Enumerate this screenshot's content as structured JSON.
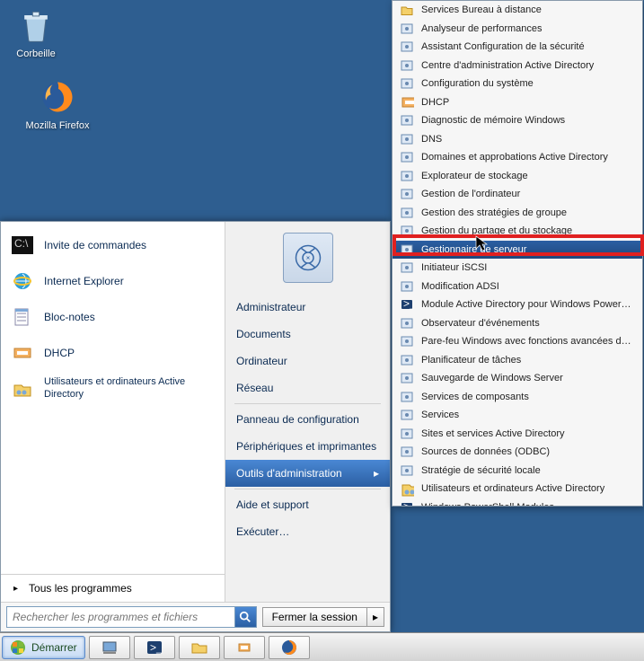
{
  "desktop": {
    "icons": [
      {
        "name": "Corbeille"
      },
      {
        "name": "Mozilla Firefox"
      }
    ]
  },
  "startmenu": {
    "pinned": [
      {
        "label": "Invite de commandes",
        "icon": "cmd-icon"
      },
      {
        "label": "Internet Explorer",
        "icon": "ie-icon"
      },
      {
        "label": "Bloc-notes",
        "icon": "notepad-icon"
      },
      {
        "label": "DHCP",
        "icon": "dhcp-icon"
      },
      {
        "label": "Utilisateurs et ordinateurs Active Directory",
        "icon": "aduc-icon"
      }
    ],
    "allprograms_arrow": "▸",
    "allprograms": "Tous les programmes",
    "search_placeholder": "Rechercher les programmes et fichiers",
    "logout_label": "Fermer la session",
    "right": [
      {
        "label": "Administrateur",
        "type": "item"
      },
      {
        "label": "Documents",
        "type": "item"
      },
      {
        "label": "Ordinateur",
        "type": "item"
      },
      {
        "label": "Réseau",
        "type": "item"
      },
      {
        "type": "sep"
      },
      {
        "label": "Panneau de configuration",
        "type": "item"
      },
      {
        "label": "Périphériques et imprimantes",
        "type": "item"
      },
      {
        "label": "Outils d'administration",
        "type": "item",
        "selected": true
      },
      {
        "type": "sep"
      },
      {
        "label": "Aide et support",
        "type": "item"
      },
      {
        "label": "Exécuter…",
        "type": "item"
      }
    ]
  },
  "admintools": {
    "items": [
      {
        "label": "Services Bureau à distance",
        "icon": "folder-icon"
      },
      {
        "label": "Analyseur de performances",
        "icon": "perf-icon"
      },
      {
        "label": "Assistant Configuration de la sécurité",
        "icon": "shield-icon"
      },
      {
        "label": "Centre d'administration Active Directory",
        "icon": "adac-icon"
      },
      {
        "label": "Configuration du système",
        "icon": "config-icon"
      },
      {
        "label": "DHCP",
        "icon": "dhcp-icon"
      },
      {
        "label": "Diagnostic de mémoire Windows",
        "icon": "memdiag-icon"
      },
      {
        "label": "DNS",
        "icon": "dns-icon"
      },
      {
        "label": "Domaines et approbations Active Directory",
        "icon": "addt-icon"
      },
      {
        "label": "Explorateur de stockage",
        "icon": "storage-icon"
      },
      {
        "label": "Gestion de l'ordinateur",
        "icon": "compmgmt-icon"
      },
      {
        "label": "Gestion des stratégies de groupe",
        "icon": "gpmc-icon"
      },
      {
        "label": "Gestion du partage et du stockage",
        "icon": "share-icon"
      },
      {
        "label": "Gestionnaire de serveur",
        "icon": "servermgr-icon",
        "highlighted": true
      },
      {
        "label": "Initiateur iSCSI",
        "icon": "iscsi-icon"
      },
      {
        "label": "Modification ADSI",
        "icon": "adsi-icon"
      },
      {
        "label": "Module Active Directory pour Windows PowerShell",
        "icon": "ps-icon"
      },
      {
        "label": "Observateur d'événements",
        "icon": "eventvwr-icon"
      },
      {
        "label": "Pare-feu Windows avec fonctions avancées de sécurité",
        "icon": "firewall-icon"
      },
      {
        "label": "Planificateur de tâches",
        "icon": "tasksched-icon"
      },
      {
        "label": "Sauvegarde de Windows Server",
        "icon": "backup-icon"
      },
      {
        "label": "Services de composants",
        "icon": "compsvc-icon"
      },
      {
        "label": "Services",
        "icon": "services-icon"
      },
      {
        "label": "Sites et services Active Directory",
        "icon": "adss-icon"
      },
      {
        "label": "Sources de données (ODBC)",
        "icon": "odbc-icon"
      },
      {
        "label": "Stratégie de sécurité locale",
        "icon": "secpol-icon"
      },
      {
        "label": "Utilisateurs et ordinateurs Active Directory",
        "icon": "aduc-icon"
      },
      {
        "label": "Windows PowerShell Modules",
        "icon": "ps-icon"
      }
    ]
  },
  "taskbar": {
    "start": "Démarrer",
    "buttons": [
      {
        "name": "server-manager-taskbar-icon"
      },
      {
        "name": "powershell-taskbar-icon"
      },
      {
        "name": "explorer-taskbar-icon"
      },
      {
        "name": "dhcp-taskbar-icon"
      },
      {
        "name": "firefox-taskbar-icon"
      }
    ]
  }
}
